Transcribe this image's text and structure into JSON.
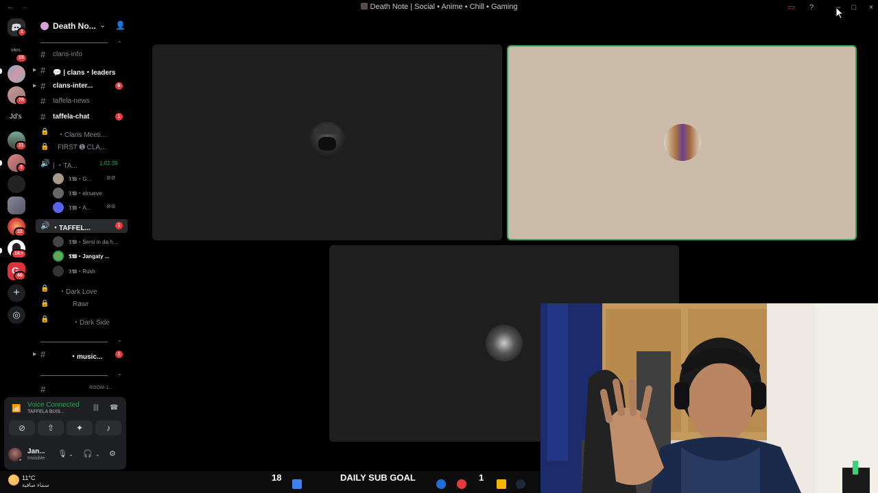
{
  "window": {
    "title": "Death Note | Social • Anime • Chill • Gaming"
  },
  "rail": {
    "home_badge": "1",
    "vinyl_label": "VINYL",
    "badges": [
      "15",
      "78",
      "11",
      "3",
      "22",
      "1K+",
      "46"
    ],
    "folder_label": "Jd's"
  },
  "guild": {
    "name": "Death No..."
  },
  "channels": [
    {
      "label": "clans-info",
      "type": "text",
      "bright": false
    },
    {
      "label": "💬 | clans・leaders",
      "type": "text",
      "bright": true
    },
    {
      "label": "clans-inter...",
      "type": "text",
      "bright": true,
      "badge": "6"
    },
    {
      "label": "taffela-news",
      "type": "text",
      "bright": false
    },
    {
      "label": "taffela-chat",
      "type": "text",
      "bright": true,
      "badge": "1"
    },
    {
      "label": "・Clans Meeti...",
      "type": "locked",
      "bright": false
    },
    {
      "label": "FIRST ➊ CLA...",
      "type": "locked",
      "bright": false
    },
    {
      "label": "| ・TA...",
      "type": "voice",
      "bright": false,
      "timer": "1:02:39"
    }
  ],
  "voice_users_1": [
    {
      "name": "𝕿𝖂・G..."
    },
    {
      "name": "𝕿𝖂・elnueve"
    },
    {
      "name": "𝕿𝖂・A..."
    }
  ],
  "selected_channel": {
    "label": "・TAFFEL...",
    "badge": "1"
  },
  "voice_users_2": [
    {
      "name": "𝕿𝖂・Sersi in da h...",
      "bright": false
    },
    {
      "name": "𝕿𝖂・Jangaty ...",
      "bright": true
    },
    {
      "name": "𝕿𝖂・Rush",
      "bright": false
    }
  ],
  "channels_2": [
    {
      "label": "・Dark Love"
    },
    {
      "label": "Rawr"
    },
    {
      "label": "・Dark Side"
    }
  ],
  "music_channel": {
    "label": "・music...",
    "badge": "1"
  },
  "room_channel": {
    "label": "ROOM-1..."
  },
  "voice_panel": {
    "status": "Voice Connected",
    "channel": "TAFFELA BUIS...",
    "user_name": "Jan...",
    "user_status": "Invisible"
  },
  "taskbar": {
    "temperature": "11°C",
    "weather_desc": "سماء صافية"
  },
  "overlay": {
    "left_count": "18",
    "goal_label": "DAILY SUB GOAL",
    "right_count": "1"
  },
  "colors": {
    "accent_green": "#23a55a",
    "badge_red": "#e23b3b",
    "speaking_border": "#3ba55c"
  }
}
